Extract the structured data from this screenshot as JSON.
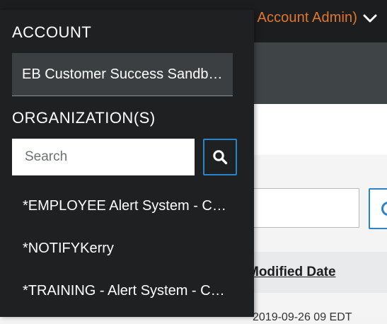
{
  "header": {
    "account_role_text": "Account Admin)"
  },
  "dropdown": {
    "account_label": "ACCOUNT",
    "account_selected": "EB Customer Success Sandbox",
    "organizations_label": "ORGANIZATION(S)",
    "search_placeholder": "Search",
    "organizations": [
      {
        "label": "*EMPLOYEE Alert System - Customer Success"
      },
      {
        "label": "*NOTIFYKerry"
      },
      {
        "label": "*TRAINING - Alert System - Customer Success"
      }
    ]
  },
  "table": {
    "modified_date_header": "Modified Date",
    "first_row_date": "2019-09-26 09 EDT"
  },
  "colors": {
    "accent_orange": "#e0772c",
    "accent_blue": "#2a84c9",
    "dropdown_bg": "#1f2022"
  }
}
